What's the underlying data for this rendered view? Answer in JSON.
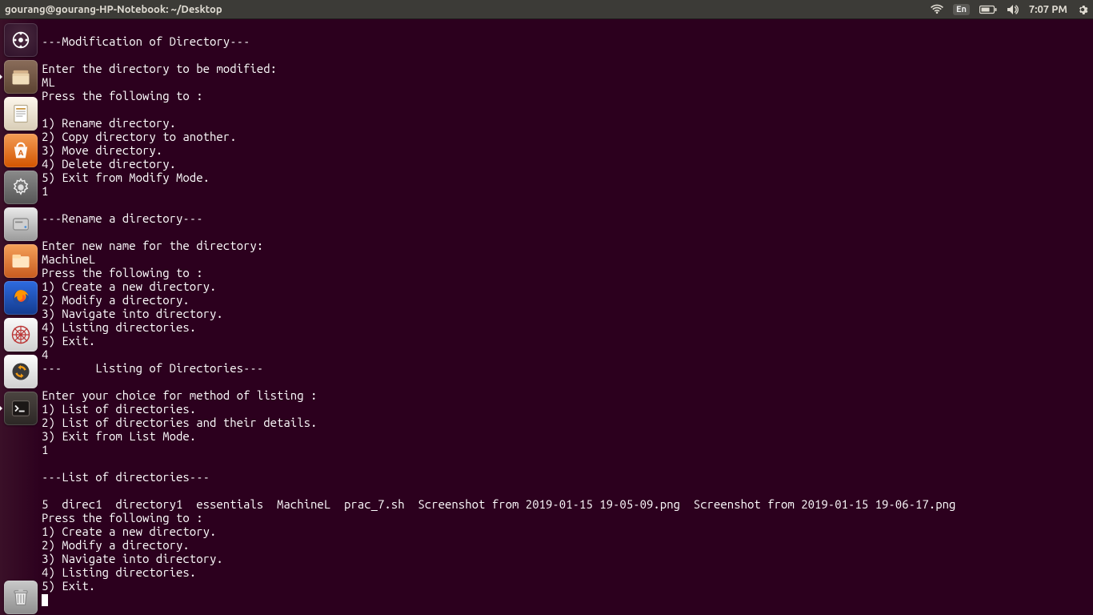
{
  "topbar": {
    "title": "gourang@gourang-HP-Notebook: ~/Desktop",
    "lang": "En",
    "time": "7:07 PM"
  },
  "launcher": {
    "items": [
      {
        "id": "dash",
        "name": "dash-icon",
        "active": false
      },
      {
        "id": "files",
        "name": "files-icon",
        "active": true
      },
      {
        "id": "office",
        "name": "office-icon",
        "active": false
      },
      {
        "id": "software",
        "name": "software-center-icon",
        "active": false
      },
      {
        "id": "settings",
        "name": "settings-icon",
        "active": false
      },
      {
        "id": "disks",
        "name": "disks-icon",
        "active": false
      },
      {
        "id": "filemanager",
        "name": "file-manager-icon",
        "active": false
      },
      {
        "id": "firefox",
        "name": "firefox-icon",
        "active": false
      },
      {
        "id": "spider",
        "name": "spider-icon",
        "active": false
      },
      {
        "id": "updater",
        "name": "software-updater-icon",
        "active": false
      },
      {
        "id": "terminal",
        "name": "terminal-icon",
        "active": true
      }
    ],
    "trash": {
      "id": "trash",
      "name": "trash-icon"
    }
  },
  "terminal_lines": [
    "---Modification of Directory---",
    "",
    "Enter the directory to be modified:",
    "ML",
    "Press the following to :",
    "",
    "1) Rename directory.",
    "2) Copy directory to another.",
    "3) Move directory.",
    "4) Delete directory.",
    "5) Exit from Modify Mode.",
    "1",
    "",
    "---Rename a directory---",
    "",
    "Enter new name for the directory:",
    "MachineL",
    "Press the following to :",
    "1) Create a new directory.",
    "2) Modify a directory.",
    "3) Navigate into directory.",
    "4) Listing directories.",
    "5) Exit.",
    "4",
    "---     Listing of Directories---",
    "",
    "Enter your choice for method of listing :",
    "1) List of directories.",
    "2) List of directories and their details.",
    "3) Exit from List Mode.",
    "1",
    "",
    "---List of directories---",
    "",
    "5  direc1  directory1  essentials  MachineL  prac_7.sh  Screenshot from 2019-01-15 19-05-09.png  Screenshot from 2019-01-15 19-06-17.png",
    "Press the following to :",
    "1) Create a new directory.",
    "2) Modify a directory.",
    "3) Navigate into directory.",
    "4) Listing directories.",
    "5) Exit."
  ]
}
